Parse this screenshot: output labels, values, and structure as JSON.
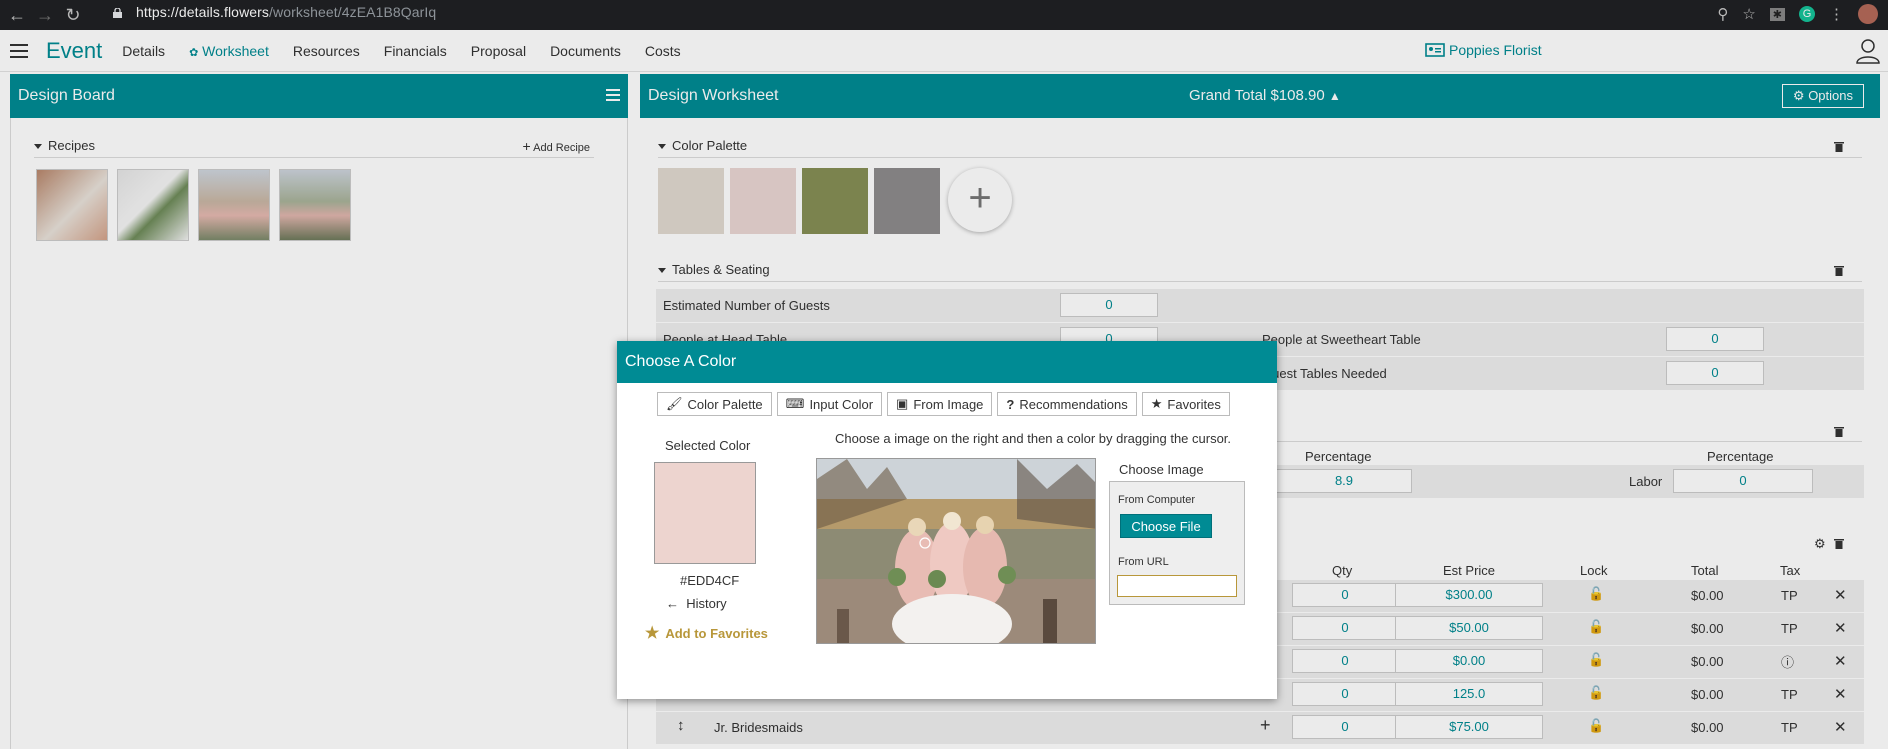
{
  "browser": {
    "url_host": "https://details.flowers",
    "url_path": "/worksheet/4zEA1B8QarIq"
  },
  "app": {
    "brand": "Event",
    "nav": [
      "Details",
      "Worksheet",
      "Resources",
      "Financials",
      "Proposal",
      "Documents",
      "Costs"
    ],
    "active_nav": "Worksheet",
    "florist": "Poppies Florist"
  },
  "design_board": {
    "title": "Design Board",
    "recipes_label": "Recipes",
    "add_recipe": "Add Recipe"
  },
  "worksheet": {
    "title": "Design Worksheet",
    "grand_total_label": "Grand Total",
    "grand_total_value": "$108.90",
    "options": "Options",
    "color_palette_label": "Color Palette",
    "palette_colors": [
      "#E1DAD0",
      "#EAD6D3",
      "#868F55",
      "#8E8B8C"
    ],
    "tables_label": "Tables & Seating",
    "est_guests_label": "Estimated Number of Guests",
    "est_guests_value": "0",
    "head_table_label": "People at Head Table",
    "head_table_value": "0",
    "sweetheart_label": "People at Sweetheart Table",
    "sweetheart_value": "0",
    "guest_tables_label": "Guest Tables Needed",
    "guest_tables_value": "0",
    "row3_value": "0",
    "percentage_label": "Percentage",
    "percentage_value": "8.9",
    "labor_label": "Labor",
    "labor_value": "0",
    "columns": {
      "qty": "Qty",
      "est_price": "Est Price",
      "lock": "Lock",
      "total": "Total",
      "tax": "Tax"
    },
    "rows": [
      {
        "name": "",
        "qty": "0",
        "price": "$300.00",
        "total": "$0.00",
        "tax": "TP"
      },
      {
        "name": "",
        "qty": "0",
        "price": "$50.00",
        "total": "$0.00",
        "tax": "TP"
      },
      {
        "name": "",
        "qty": "0",
        "price": "$0.00",
        "total": "$0.00",
        "tax": "info"
      },
      {
        "name": "",
        "qty": "0",
        "price": "125.0",
        "total": "$0.00",
        "tax": "TP"
      },
      {
        "name": "Jr. Bridesmaids",
        "qty": "0",
        "price": "$75.00",
        "total": "$0.00",
        "tax": "TP"
      }
    ]
  },
  "modal": {
    "title": "Choose A Color",
    "tabs": [
      "Color Palette",
      "Input Color",
      "From Image",
      "Recommendations",
      "Favorites"
    ],
    "selected_label": "Selected Color",
    "selected_hex": "#EDD4CF",
    "selected_color": "#EDD4CF",
    "history": "History",
    "add_favorites": "Add to Favorites",
    "instruction": "Choose a image on the right and then a color by dragging the cursor.",
    "choose_image": "Choose Image",
    "from_computer": "From Computer",
    "choose_file": "Choose File",
    "from_url": "From URL",
    "url_value": ""
  }
}
